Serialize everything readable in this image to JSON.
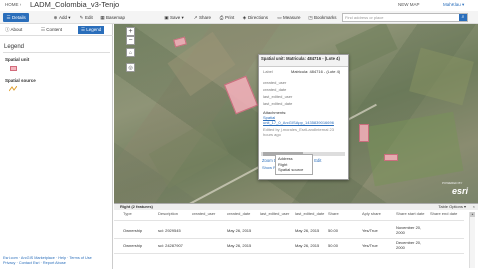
{
  "topbar": {
    "home": "HOME ›",
    "title": "LADM_Colombia_v3-Tenjo",
    "new_map": "NEW MAP",
    "user": "MahKlau ▾"
  },
  "toolbar": {
    "details": "Details",
    "add": "Add ▾",
    "edit": "Edit",
    "basemap": "Basemap",
    "save": "Save ▾",
    "share": "Share",
    "print": "Print",
    "directions": "Directions",
    "measure": "Measure",
    "bookmarks": "Bookmarks",
    "search_placeholder": "Find address or place"
  },
  "sidebar": {
    "tabs": [
      "About",
      "Content",
      "Legend"
    ],
    "active_tab": "Legend",
    "legend_title": "Legend",
    "layers": [
      {
        "label": "Spatial unit",
        "icon": "polygon-swatch"
      },
      {
        "label": "Spatial source",
        "icon": "line-swatch"
      }
    ],
    "footer_lines": [
      "Esri.com · ArcGIS Marketplace · Help · Terms of Use",
      "Privacy · Contact Esri · Report Abuse"
    ]
  },
  "map": {
    "zoom_in": "+",
    "zoom_out": "−",
    "esri_logo": "esri",
    "esri_powered": "POWERED BY"
  },
  "popup": {
    "title": "Spatial unit: Matricula: 484716 - (Lote 4)",
    "rows": [
      {
        "k": "Label",
        "v": "Matricula: 484716 - (Lote 4)"
      },
      {
        "k": "created_user",
        "v": ""
      },
      {
        "k": "created_date",
        "v": ""
      },
      {
        "k": "last_edited_user",
        "v": ""
      },
      {
        "k": "last_edited_date",
        "v": ""
      }
    ],
    "attachments_label": "Attachments:",
    "attachment_links": [
      "Spatial",
      "unit_17_0_ArcGISApp_1435839016696"
    ],
    "edited_by": "Edited by j.morales_EsriLandInternal 23 hours ago",
    "zoom_to": "Zoom to",
    "get_directions": "Get Directions",
    "edit": "Edit",
    "show_related": "Show Related Records",
    "related_menu": [
      "Address",
      "Right",
      "Spatial source"
    ]
  },
  "table": {
    "title": "Right (2 features)",
    "options": "Table Options ▾",
    "close": "×",
    "columns": [
      "Type",
      "Description",
      "created_user",
      "created_date",
      "last_edited_user",
      "last_edited_date",
      "Share",
      "Aply share",
      "Share start date",
      "Share end date"
    ],
    "rows": [
      [
        "Ownership",
        "sci: 2929545",
        "",
        "May 26, 2015",
        "",
        "May 26, 2015",
        "50.00",
        "Yes/True",
        "November 20, 2000",
        ""
      ],
      [
        "Ownership",
        "sci: 24287907",
        "",
        "May 26, 2015",
        "",
        "May 26, 2015",
        "50.00",
        "Yes/True",
        "December 20, 2000",
        ""
      ]
    ]
  },
  "colors": {
    "accent": "#2a6ebb",
    "parcel_fill": "#f6b0bc",
    "parcel_stroke": "#c96d7c"
  }
}
